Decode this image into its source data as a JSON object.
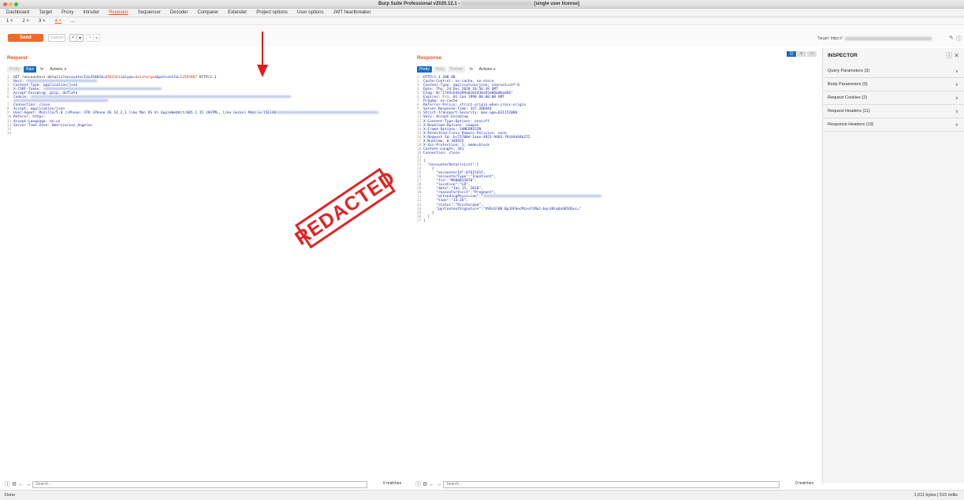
{
  "window": {
    "title": "Burp Suite Professional v2020.12.1 -",
    "title_suffix": "[single user license]"
  },
  "menu": {
    "items": [
      "Dashboard",
      "Target",
      "Proxy",
      "Intruder",
      "Repeater",
      "Sequencer",
      "Decoder",
      "Comparer",
      "Extender",
      "Project options",
      "User options",
      "JWT heartbreaker"
    ],
    "active": "Repeater"
  },
  "subtabs": [
    "1 ×",
    "2 ×",
    "3 ×",
    "4 ×",
    "..."
  ],
  "toolbar": {
    "send_label": "Send",
    "cancel_label": "Cancel",
    "back_label": "<",
    "back_dd": "▾",
    "forward_label": ">",
    "forward_dd": "▾",
    "target_label": "Target: https://"
  },
  "request": {
    "title": "Request",
    "tabs": [
      "Pretty",
      "Raw",
      "\\n",
      "Actions ∨"
    ],
    "lines": [
      {
        "n": "1",
        "parts": [
          {
            "t": "GET /encounters-details?",
            "c": "bk"
          },
          {
            "t": "encounterIds458650=",
            "c": "n"
          },
          {
            "t": "07615411",
            "c": "hl"
          },
          {
            "t": "&type=",
            "c": "n"
          },
          {
            "t": "discharged",
            "c": "hl"
          },
          {
            "t": "&patientId=",
            "c": "n"
          },
          {
            "t": "12593987",
            "c": "hl"
          },
          {
            "t": " HTTP/1.1",
            "c": "bk"
          }
        ]
      },
      {
        "n": "2",
        "parts": [
          {
            "t": "Host: ",
            "c": "n"
          }
        ]
      },
      {
        "n": "3",
        "parts": [
          {
            "t": "Content-Type: application/json",
            "c": "n"
          }
        ]
      },
      {
        "n": "4",
        "parts": [
          {
            "t": "X-CSRF-Token: ",
            "c": "n"
          }
        ]
      },
      {
        "n": "5",
        "parts": [
          {
            "t": "Accept-Encoding: gzip, deflate",
            "c": "n"
          }
        ]
      },
      {
        "n": "6",
        "parts": [
          {
            "t": "Cookie: ",
            "c": "n"
          }
        ]
      },
      {
        "n": "",
        "parts": [
          {
            "t": "",
            "c": "n"
          }
        ]
      },
      {
        "n": "7",
        "parts": [
          {
            "t": "Connection: close",
            "c": "n"
          }
        ]
      },
      {
        "n": "8",
        "parts": [
          {
            "t": "Accept: application/json",
            "c": "n"
          }
        ]
      },
      {
        "n": "9",
        "parts": [
          {
            "t": "User-Agent: Mozilla/5.0 (iPhone; CPU iPhone OS 14_2_1 like Mac OS X) AppleWebKit/605.1.15 (KHTML, like Gecko) Mobile/15E148",
            "c": "n"
          }
        ]
      },
      {
        "n": "10",
        "parts": [
          {
            "t": "Referer: https:",
            "c": "n"
          }
        ]
      },
      {
        "n": "11",
        "parts": [
          {
            "t": "Accept-Language: en-us",
            "c": "n"
          }
        ]
      },
      {
        "n": "12",
        "parts": [
          {
            "t": "Server-Time-Zone: America/Los_Angeles",
            "c": "n"
          }
        ]
      },
      {
        "n": "13",
        "parts": [
          {
            "t": "",
            "c": "n"
          }
        ]
      },
      {
        "n": "14",
        "parts": [
          {
            "t": "",
            "c": "n"
          }
        ]
      }
    ]
  },
  "response": {
    "title": "Response",
    "tabs": [
      "Pretty",
      "Raw",
      "Render",
      "\\n",
      "Actions ∨"
    ],
    "lines": [
      "HTTP/1.1 200 OK",
      "Cache-Control: no-cache, no-store",
      "Content-Type: application/json; charset=utf-8",
      "Date: Thu, 24 Dec 2020 18:56:39 GMT",
      "Etag: W/\"17d4cb4b389a0103d30e65e06b0bad66\"",
      "Expires: Fri, 01 Jan 1990 00:00:00 GMT",
      "Pragma: no-cache",
      "Referrer-Policy: strict-origin-when-cross-origin",
      "Server-Response-Time: 347.206944",
      "Strict-Transport-Security: max-age=631152000",
      "Vary: Accept-Encoding",
      "X-Content-Type-Options: nosniff",
      "X-Download-Options: noopen",
      "X-Frame-Options: SAMEORIGIN",
      "X-Permitted-Cross-Domain-Policies: none",
      "X-Request-Id: bc73708d-1eae-4921-9483-f9cb9444b272",
      "X-Runtime: 0.346925",
      "X-Xss-Protection: 1; mode=block",
      "Content-Length: 341",
      "Connection: close",
      "",
      "{",
      "  \"encounterDetailsList\":[",
      "    {",
      "      \"encounterId\":07615411,",
      "      \"encounterType\":\"Inpatient\",",
      "      \"fin\":\"MX00015078\",",
      "      \"location\":\"LD\",",
      "      \"date\":\"Jan 15, 2018\",",
      "      \"reasonForVisit\":\"Pregnant\",",
      "      \"attendingPhysician\":\"",
      "      \"time\":\"13:26\",",
      "      \"status\":\"Discharged\",",
      "      \"pprContextSignature\":\"VSRc6l8B_BpJOF6ecMzxsF1Ma2-bqcsNlqdaSB5OGoc=\"",
      "    }",
      "  ]",
      "}"
    ]
  },
  "stamp": "REDACTED",
  "inspector": {
    "title": "INSPECTOR",
    "rows": [
      "Query Parameters (3)",
      "Body Parameters (0)",
      "Request Cookies (2)",
      "Request Headers (11)",
      "Response Headers (19)"
    ]
  },
  "search": {
    "placeholder": "Search...",
    "matches": "0 matches"
  },
  "status": {
    "left": "Done",
    "right": "1,011 bytes | 515 millis"
  },
  "colors": {
    "accent": "#e8531e",
    "send": "#f26a2a",
    "code": "#1c2aa5",
    "highlight": "#d6261b",
    "stamp": "#e12424"
  }
}
